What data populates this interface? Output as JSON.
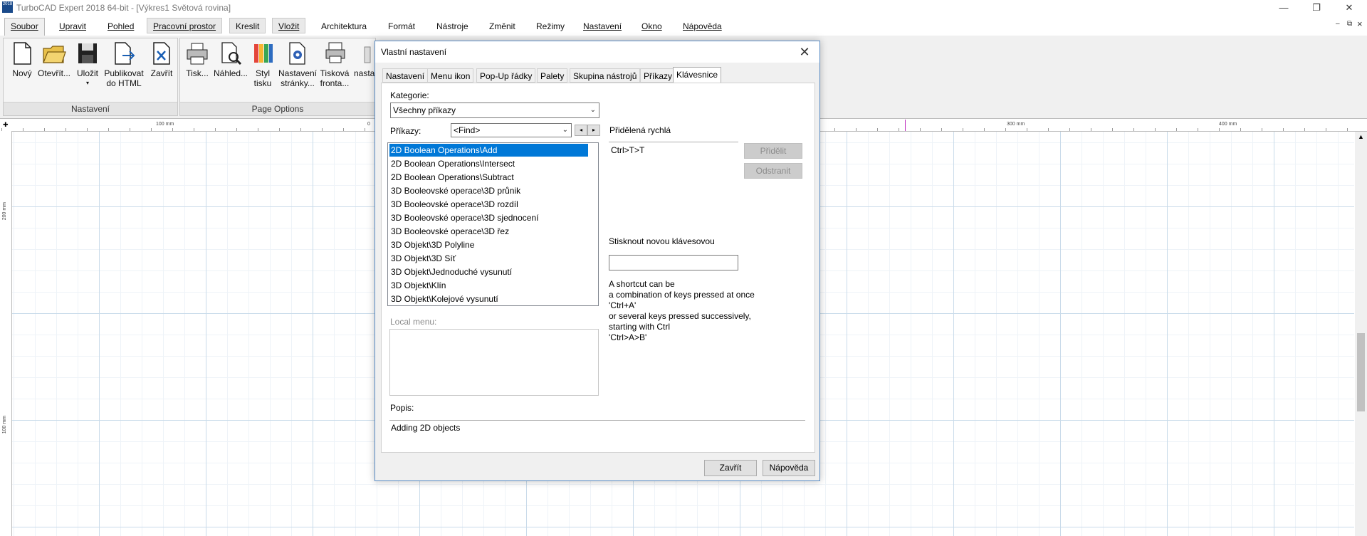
{
  "window": {
    "title": "TurboCAD Expert 2018 64-bit - [Výkres1 Světová rovina]",
    "icon_text": "2018",
    "minimize": "—",
    "restore": "❐",
    "close": "✕"
  },
  "menu": {
    "tabs": [
      "Soubor",
      "Upravit",
      "Pohled",
      "Pracovní prostor",
      "Kreslit",
      "Vložit",
      "Architektura",
      "Formát",
      "Nástroje",
      "Změnit",
      "Režimy",
      "Nastavení",
      "Okno",
      "Nápověda"
    ],
    "mdi_min": "–",
    "mdi_restore": "⧉",
    "mdi_close": "×"
  },
  "ribbon": {
    "group1": {
      "label": "Nastavení",
      "buttons": [
        "Nový",
        "Otevřít...",
        "Uložit",
        "Publikovat do HTML",
        "Zavřít"
      ]
    },
    "group2": {
      "label": "Page Options",
      "buttons": [
        "Tisk...",
        "Náhled...",
        "Styl tisku",
        "Nastavení stránky...",
        "Tisková fronta..."
      ],
      "partial": "nasta"
    }
  },
  "rulers": {
    "h": [
      "100 mm",
      "0",
      "300 mm",
      "400 mm"
    ],
    "v": [
      "200 mm",
      "100 mm"
    ]
  },
  "dialog": {
    "title": "Vlastní nastavení",
    "tabs": [
      "Nastavení",
      "Menu ikon",
      "Pop-Up řádky",
      "Palety",
      "Skupina nástrojů",
      "Příkazy",
      "Klávesnice"
    ],
    "active_tab": "Klávesnice",
    "category_label": "Kategorie:",
    "category_value": "Všechny příkazy",
    "commands_label": "Příkazy:",
    "find_value": "<Find>",
    "commands": [
      "2D Boolean Operations\\Add",
      "2D Boolean Operations\\Intersect",
      "2D Boolean Operations\\Subtract",
      "3D Booleovské operace\\3D průnik",
      "3D Booleovské operace\\3D rozdíl",
      "3D Booleovské operace\\3D sjednocení",
      "3D Booleovské operace\\3D řez",
      "3D Objekt\\3D Polyline",
      "3D Objekt\\3D Síť",
      "3D Objekt\\Jednoduché vysunutí",
      "3D Objekt\\Klín",
      "3D Objekt\\Kolejové vysunutí"
    ],
    "selected_command": "2D Boolean Operations\\Add",
    "assigned_label": "Přidělená rychlá",
    "assigned_value": "Ctrl>T>T",
    "assign_button": "Přidělit",
    "remove_button": "Odstranit",
    "new_key_label": "Stisknout novou klávesovou",
    "new_key_value": "",
    "help_lines": [
      "A shortcut can be",
      "a combination of keys pressed at once",
      "'Ctrl+A'",
      "or several keys pressed successively,",
      "starting with Ctrl",
      "'Ctrl>A>B'"
    ],
    "local_menu_label": "Local menu:",
    "description_label": "Popis:",
    "description_value": "Adding 2D objects",
    "close_button": "Zavřít",
    "help_button": "Nápověda"
  }
}
